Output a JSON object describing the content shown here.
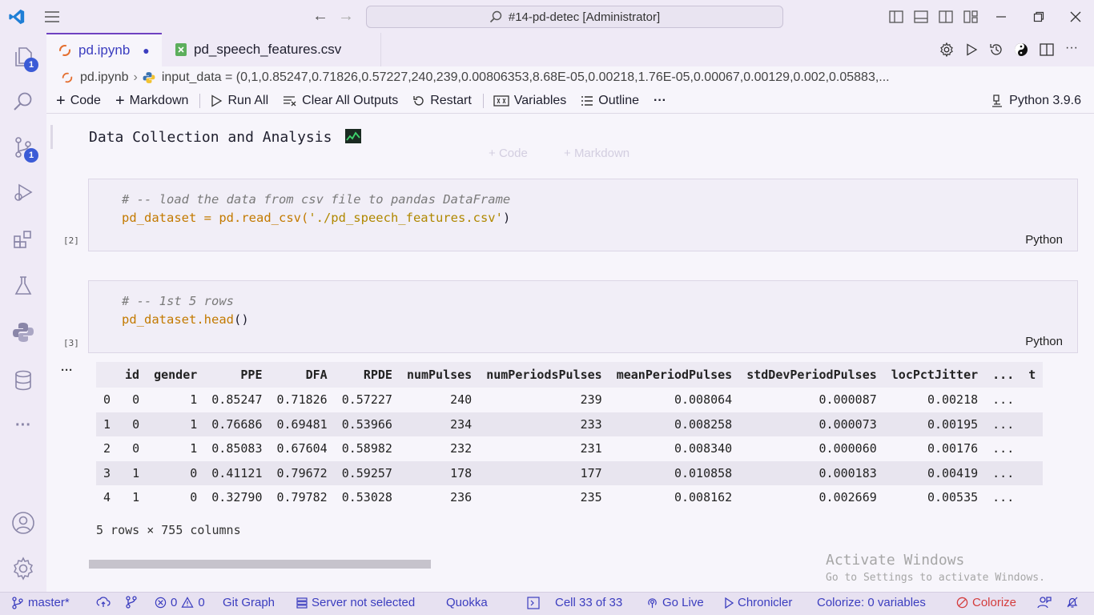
{
  "title_bar": {
    "search_text": "#14-pd-detec [Administrator]",
    "back_label": "←",
    "forward_label": "→"
  },
  "activity_bar": {
    "explorer_badge": "1",
    "scm_badge": "1",
    "more_label": "···"
  },
  "tabs": [
    {
      "label": "pd.ipynb",
      "dirty": "●"
    },
    {
      "label": "pd_speech_features.csv"
    }
  ],
  "breadcrumb": {
    "file": "pd.ipynb",
    "symbol": "input_data = (0,1,0.85247,0.71826,0.57227,240,239,0.00806353,8.68E-05,0.00218,1.76E-05,0.00067,0.00129,0.002,0.05883,..."
  },
  "toolbar": {
    "code": "Code",
    "markdown": "Markdown",
    "run_all": "Run All",
    "clear_outputs": "Clear All Outputs",
    "restart": "Restart",
    "variables": "Variables",
    "outline": "Outline",
    "more": "···",
    "kernel": "Python 3.9.6"
  },
  "notebook": {
    "markdown_heading": "Data Collection and Analysis",
    "markdown_emoji": "📈",
    "add_code": "Code",
    "add_markdown": "Markdown",
    "cells": [
      {
        "exec_count": "[2]",
        "comment": "# -- load the data from csv file to pandas DataFrame",
        "code_var": "pd_dataset",
        "code_op": " = ",
        "code_call": "pd.read_csv(",
        "code_str": "'./pd_speech_features.csv'",
        "code_end": ")",
        "language": "Python"
      },
      {
        "exec_count": "[3]",
        "comment": "# -- 1st 5 rows",
        "code_call": "pd_dataset.head",
        "code_end": "()",
        "language": "Python"
      }
    ],
    "output_more": "···",
    "dataframe": {
      "columns": [
        "",
        "id",
        "gender",
        "PPE",
        "DFA",
        "RPDE",
        "numPulses",
        "numPeriodsPulses",
        "meanPeriodPulses",
        "stdDevPeriodPulses",
        "locPctJitter",
        "...",
        "t"
      ],
      "rows": [
        [
          "0",
          "0",
          "1",
          "0.85247",
          "0.71826",
          "0.57227",
          "240",
          "239",
          "0.008064",
          "0.000087",
          "0.00218",
          "...",
          ""
        ],
        [
          "1",
          "0",
          "1",
          "0.76686",
          "0.69481",
          "0.53966",
          "234",
          "233",
          "0.008258",
          "0.000073",
          "0.00195",
          "...",
          ""
        ],
        [
          "2",
          "0",
          "1",
          "0.85083",
          "0.67604",
          "0.58982",
          "232",
          "231",
          "0.008340",
          "0.000060",
          "0.00176",
          "...",
          ""
        ],
        [
          "3",
          "1",
          "0",
          "0.41121",
          "0.79672",
          "0.59257",
          "178",
          "177",
          "0.010858",
          "0.000183",
          "0.00419",
          "...",
          ""
        ],
        [
          "4",
          "1",
          "0",
          "0.32790",
          "0.79782",
          "0.53028",
          "236",
          "235",
          "0.008162",
          "0.002669",
          "0.00535",
          "...",
          ""
        ]
      ],
      "summary": "5 rows × 755 columns"
    },
    "watermark_title": "Activate Windows",
    "watermark_sub": "Go to Settings to activate Windows."
  },
  "status_bar": {
    "branch": "master*",
    "errors": "0",
    "warnings": "0",
    "git_graph": "Git Graph",
    "server": "Server not selected",
    "quokka": "Quokka",
    "cell_pos": "Cell 33 of 33",
    "go_live": "Go Live",
    "chronicler": "Chronicler",
    "colorize_vars": "Colorize: 0 variables",
    "colorize": "Colorize"
  }
}
